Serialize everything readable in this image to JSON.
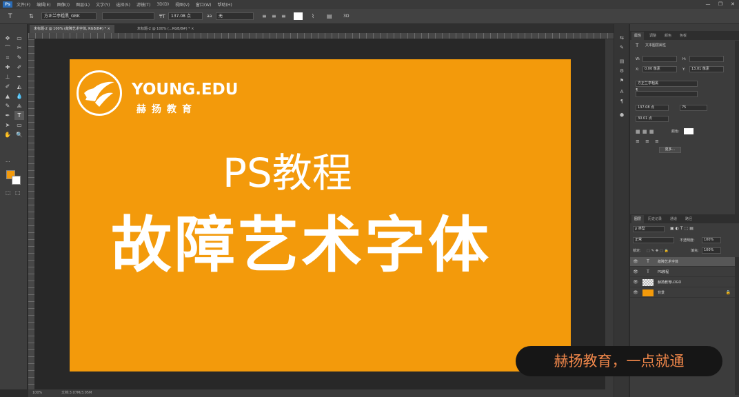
{
  "colors": {
    "canvas_bg": "#f39a0b",
    "ui_dark": "#2b2b2b",
    "accent_orange": "#f39a0b",
    "subtitle_text": "#f0874a"
  },
  "menubar": {
    "logo": "Ps",
    "items": [
      "文件(F)",
      "编辑(E)",
      "图像(I)",
      "图层(L)",
      "文字(Y)",
      "选择(S)",
      "滤镜(T)",
      "3D(D)",
      "视图(V)",
      "窗口(W)",
      "帮助(H)"
    ],
    "window_controls": [
      "—",
      "❐",
      "✕"
    ]
  },
  "options": {
    "tool_glyph": "T",
    "orient_glyph": "⇅",
    "font_family": "方正兰亭粗黑_GBK",
    "font_style": "",
    "size_icon": "₸T",
    "font_size": "137.08 点",
    "aa_icon": "aa",
    "aa_value": "无",
    "align_icons": [
      "≡",
      "≡",
      "≡"
    ],
    "warp_icon": "⌇",
    "panel_icon": "▤",
    "three_d_icon": "3D"
  },
  "tools": [
    [
      "✥",
      "▭"
    ],
    [
      "⌒",
      "✂"
    ],
    [
      "⌗",
      "✎"
    ],
    [
      "✚",
      "✐"
    ],
    [
      "⊥",
      "✒"
    ],
    [
      "✐",
      "◭"
    ],
    [
      "▲",
      "💧"
    ],
    [
      "✎",
      "⟁"
    ],
    [
      "✒",
      "T"
    ],
    [
      "➤",
      "▭"
    ],
    [
      "✋",
      "🔍"
    ]
  ],
  "tool_extras": [
    "···",
    "⬚",
    "⬚"
  ],
  "tabs": [
    "未标题-2 @ 100% (故障艺术字体, RGB/8#) * ×",
    "未标题-2 @ 100% (...RGB/8#) * ×"
  ],
  "canvas": {
    "logo_wordmark": "YOUNG.EDU",
    "logo_cn": "赫扬教育",
    "title_line1": "PS教程",
    "title_line2": "故障艺术字体"
  },
  "status": {
    "zoom": "100%",
    "doc_info": "文档:3.07M/3.05M"
  },
  "icon_strip": [
    "⇆",
    "✎",
    "▤",
    "⚙",
    "⚑",
    "A",
    "¶",
    "⬢"
  ],
  "properties": {
    "tabs": [
      "属性",
      "调整",
      "颜色",
      "色板"
    ],
    "header_icon": "T",
    "header_label": "文本图层属性",
    "w_label": "W:",
    "w_value": "",
    "h_label": "H:",
    "h_value": "",
    "x_label": "X:",
    "x_value": "0.00 像素",
    "y_label": "Y:",
    "y_value": "13.01 像素",
    "char_label_a": "A",
    "char_label_para": "¶",
    "font": "方正兰亭粗黑",
    "font_style": "",
    "size_value": "137.08 点",
    "leading_value": "75",
    "tracking_value": "30.01 点",
    "color_label": "颜色:",
    "more_button": "更多..."
  },
  "layers": {
    "tabs": [
      "图层",
      "历史记录",
      "通道",
      "路径"
    ],
    "filter_label": "ρ 类型",
    "blend_mode": "正常",
    "opacity_label": "不透明度:",
    "opacity_value": "100%",
    "lock_label": "锁定:",
    "fill_label": "填充:",
    "fill_value": "100%",
    "rows": [
      {
        "name": "故障艺术字体",
        "thumb": "T",
        "selected": true,
        "lock": ""
      },
      {
        "name": "PS教程",
        "thumb": "T",
        "selected": false,
        "lock": ""
      },
      {
        "name": "赫扬教育LOGO",
        "thumb": "",
        "selected": false,
        "lock": ""
      },
      {
        "name": "背景",
        "thumb": "",
        "selected": false,
        "lock": "🔒"
      }
    ],
    "eye": "👁"
  },
  "subtitle": "赫扬教育，一点就通"
}
